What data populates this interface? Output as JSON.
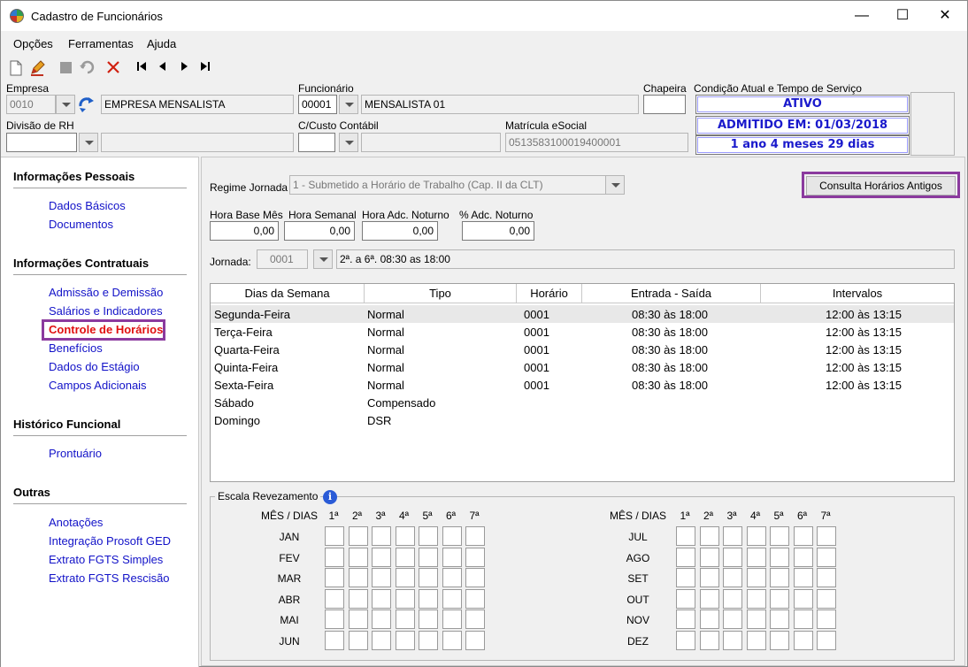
{
  "window": {
    "title": "Cadastro de Funcionários",
    "controls": {
      "minimize": "—",
      "maximize": "☐",
      "close": "✕"
    }
  },
  "menu": [
    "Opções",
    "Ferramentas",
    "Ajuda"
  ],
  "header": {
    "empresa_label": "Empresa",
    "empresa_code": "0010",
    "empresa_name": "EMPRESA MENSALISTA",
    "funcionario_label": "Funcionário",
    "funcionario_code": "00001",
    "funcionario_name": "MENSALISTA 01",
    "chapeira_label": "Chapeira",
    "chapeira_value": "",
    "condicao_label": "Condição Atual e Tempo de Serviço",
    "status": "ATIVO",
    "admitido": "ADMITIDO EM: 01/03/2018",
    "tempo_servico": "1 ano 4 meses 29 dias",
    "divisao_label": "Divisão de RH",
    "divisao_value": "",
    "custo_label": "C/Custo Contábil",
    "custo_value": "",
    "matricula_label": "Matrícula eSocial",
    "matricula_value": "0513583100019400001"
  },
  "sidebar": {
    "sections": [
      {
        "title": "Informações Pessoais",
        "items": [
          "Dados Básicos",
          "Documentos"
        ]
      },
      {
        "title": "Informações Contratuais",
        "items": [
          "Admissão e Demissão",
          "Salários e Indicadores",
          "Controle de Horários",
          "Benefícios",
          "Dados do Estágio",
          "Campos Adicionais"
        ]
      },
      {
        "title": "Histórico Funcional",
        "items": [
          "Prontuário"
        ]
      },
      {
        "title": "Outras",
        "items": [
          "Anotações",
          "Integração Prosoft GED",
          "Extrato FGTS Simples",
          "Extrato FGTS Rescisão"
        ]
      }
    ],
    "active": "Controle de Horários"
  },
  "main": {
    "regime_label": "Regime Jornada",
    "regime_value": "1 - Submetido a Horário de Trabalho (Cap. II da CLT)",
    "consulta_button": "Consulta Horários Antigos",
    "hora_base_label": "Hora Base Mês",
    "hora_base_value": "0,00",
    "hora_semanal_label": "Hora Semanal",
    "hora_semanal_value": "0,00",
    "hora_adc_label": "Hora Adc. Noturno",
    "hora_adc_value": "0,00",
    "pct_adc_label": "% Adc. Noturno",
    "pct_adc_value": "0,00",
    "jornada_label": "Jornada:",
    "jornada_code": "0001",
    "jornada_desc": "2ª. a 6ª. 08:30 as 18:00"
  },
  "grid": {
    "headers": [
      "Dias da Semana",
      "Tipo",
      "Horário",
      "Entrada - Saída",
      "Intervalos"
    ],
    "rows": [
      [
        "Segunda-Feira",
        "Normal",
        "0001",
        "08:30 às 18:00",
        "12:00 às 13:15"
      ],
      [
        "Terça-Feira",
        "Normal",
        "0001",
        "08:30 às 18:00",
        "12:00 às 13:15"
      ],
      [
        "Quarta-Feira",
        "Normal",
        "0001",
        "08:30 às 18:00",
        "12:00 às 13:15"
      ],
      [
        "Quinta-Feira",
        "Normal",
        "0001",
        "08:30 às 18:00",
        "12:00 às 13:15"
      ],
      [
        "Sexta-Feira",
        "Normal",
        "0001",
        "08:30 às 18:00",
        "12:00 às 13:15"
      ],
      [
        "Sábado",
        "Compensado",
        "",
        "",
        ""
      ],
      [
        "Domingo",
        "DSR",
        "",
        "",
        ""
      ]
    ]
  },
  "escala": {
    "title": "Escala Revezamento",
    "month_header": "MÊS / DIAS",
    "days": [
      "1ª",
      "2ª",
      "3ª",
      "4ª",
      "5ª",
      "6ª",
      "7ª"
    ],
    "months_left": [
      "JAN",
      "FEV",
      "MAR",
      "ABR",
      "MAI",
      "JUN"
    ],
    "months_right": [
      "JUL",
      "AGO",
      "SET",
      "OUT",
      "NOV",
      "DEZ"
    ]
  }
}
